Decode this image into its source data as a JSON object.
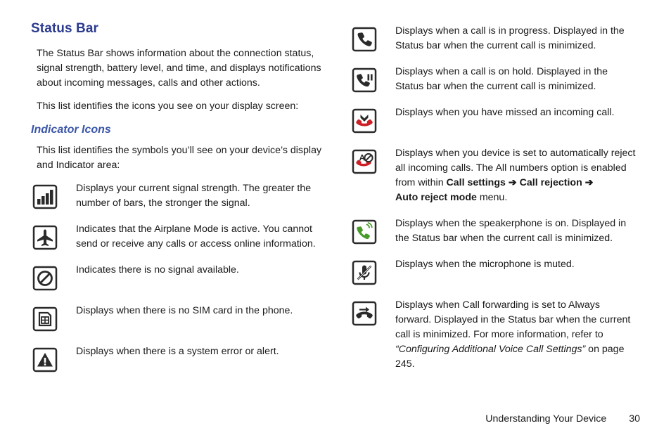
{
  "left": {
    "title": "Status Bar",
    "paragraphs": [
      "The Status Bar shows information about the connection status, signal strength, battery level, and time, and displays notifications about incoming messages, calls and other actions.",
      "This list identifies the icons you see on your display screen:"
    ],
    "subtitle": "Indicator Icons",
    "subtitle_paragraph": "This list identifies the symbols you’ll see on your device’s display and Indicator area:",
    "items": [
      {
        "icon": "signal-strength-icon",
        "text": "Displays your current signal strength. The greater the number of bars, the stronger the signal."
      },
      {
        "icon": "airplane-mode-icon",
        "text": "Indicates that the Airplane Mode is active. You cannot send or receive any calls or access online information."
      },
      {
        "icon": "no-signal-icon",
        "text": "Indicates there is no signal available."
      },
      {
        "icon": "no-sim-card-icon",
        "text": "Displays when there is no SIM card in the phone."
      },
      {
        "icon": "system-error-alert-icon",
        "text": "Displays when there is a system error or alert."
      }
    ]
  },
  "right": {
    "items": [
      {
        "icon": "call-in-progress-icon",
        "text": "Displays when a call is in progress. Displayed in the Status bar when the current call is minimized."
      },
      {
        "icon": "call-on-hold-icon",
        "text": "Displays when a call is on hold. Displayed in the Status bar when the current call is minimized."
      },
      {
        "icon": "missed-call-icon",
        "text": "Displays when you have missed an incoming call."
      },
      {
        "icon": "auto-reject-call-icon",
        "text_parts": [
          {
            "style": "normal",
            "text": "Displays when you device is set to automatically reject all incoming calls. The All numbers option is enabled from within "
          },
          {
            "style": "bold",
            "text": "Call settings"
          },
          {
            "style": "bold",
            "text": " ➔ "
          },
          {
            "style": "bold",
            "text": "Call rejection"
          },
          {
            "style": "bold",
            "text": " ➔ "
          },
          {
            "style": "bold",
            "text": "Auto reject mode"
          },
          {
            "style": "normal",
            "text": " menu."
          }
        ]
      },
      {
        "icon": "speakerphone-on-icon",
        "text": "Displays when the speakerphone is on. Displayed in the Status bar when the current call is minimized."
      },
      {
        "icon": "microphone-muted-icon",
        "text": "Displays when the microphone is muted."
      },
      {
        "icon": "call-forwarding-icon",
        "text_parts": [
          {
            "style": "normal",
            "text": "Displays when Call forwarding is set to Always forward. Displayed in the Status bar when the current call is minimized. For more information, refer to "
          },
          {
            "style": "italic",
            "text": "“Configuring Additional Voice Call Settings”"
          },
          {
            "style": "normal",
            "text": " on page 245."
          }
        ]
      }
    ]
  },
  "footer": {
    "chapter": "Understanding Your Device",
    "page_number": "30"
  },
  "colors": {
    "title": "#2b3a8f",
    "subtitle": "#3b56a8",
    "body": "#1a1a1a",
    "icon_dark": "#2a2a2a",
    "icon_red": "#cc2026",
    "icon_green": "#4a9a2a"
  }
}
